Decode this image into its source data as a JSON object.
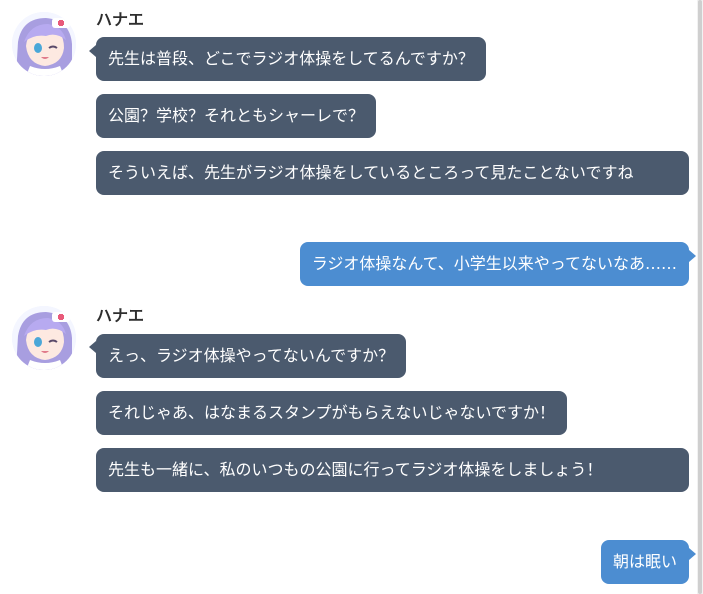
{
  "colors": {
    "incoming_bubble": "#4b5a6e",
    "outgoing_bubble": "#4c8dd1",
    "name_text": "#2e2e2e",
    "background": "#ffffff"
  },
  "conversation": {
    "groups": [
      {
        "sender": "ハナエ",
        "avatar_icon": "character-avatar-icon",
        "messages": [
          "先生は普段、どこでラジオ体操をしてるんですか？",
          "公園？学校？それともシャーレで？",
          "そういえば、先生がラジオ体操をしているところって見たことないですね"
        ]
      },
      {
        "sender": "self",
        "messages": [
          "ラジオ体操なんて、小学生以来やってないなあ……"
        ]
      },
      {
        "sender": "ハナエ",
        "avatar_icon": "character-avatar-icon",
        "messages": [
          "えっ、ラジオ体操やってないんですか？",
          "それじゃあ、はなまるスタンプがもらえないじゃないですか！",
          "先生も一緒に、私のいつもの公園に行ってラジオ体操をしましょう！"
        ]
      },
      {
        "sender": "self",
        "messages": [
          "朝は眠い"
        ]
      }
    ]
  }
}
